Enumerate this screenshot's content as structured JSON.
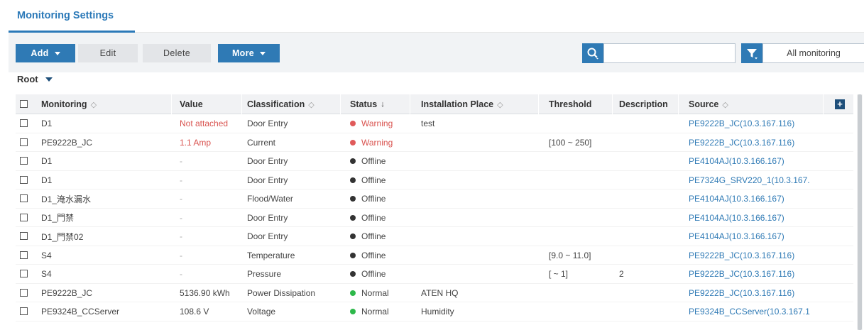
{
  "tab": {
    "label": "Monitoring Settings"
  },
  "toolbar": {
    "add_label": "Add",
    "edit_label": "Edit",
    "delete_label": "Delete",
    "more_label": "More",
    "search_value": "",
    "filter_value": "All monitoring"
  },
  "breadcrumb": {
    "root_label": "Root"
  },
  "columns": [
    "Monitoring",
    "Value",
    "Classification",
    "Status",
    "Installation Place",
    "Threshold",
    "Description",
    "Source"
  ],
  "rows": [
    {
      "monitoring": "D1",
      "value": "Not attached",
      "classification": "Door Entry",
      "status": "Warning",
      "place": "test",
      "threshold": "",
      "description": "",
      "source": "PE9222B_JC(10.3.167.116)"
    },
    {
      "monitoring": "PE9222B_JC",
      "value": "1.1 Amp",
      "classification": "Current",
      "status": "Warning",
      "place": "",
      "threshold": "[100 ~ 250]",
      "description": "",
      "source": "PE9222B_JC(10.3.167.116)"
    },
    {
      "monitoring": "D1",
      "value": "-",
      "classification": "Door Entry",
      "status": "Offline",
      "place": "",
      "threshold": "",
      "description": "",
      "source": "PE4104AJ(10.3.166.167)"
    },
    {
      "monitoring": "D1",
      "value": "-",
      "classification": "Door Entry",
      "status": "Offline",
      "place": "",
      "threshold": "",
      "description": "",
      "source": "PE7324G_SRV220_1(10.3.167."
    },
    {
      "monitoring": "D1_淹水漏水",
      "value": "-",
      "classification": "Flood/Water",
      "status": "Offline",
      "place": "",
      "threshold": "",
      "description": "",
      "source": "PE4104AJ(10.3.166.167)"
    },
    {
      "monitoring": "D1_門禁",
      "value": "-",
      "classification": "Door Entry",
      "status": "Offline",
      "place": "",
      "threshold": "",
      "description": "",
      "source": "PE4104AJ(10.3.166.167)"
    },
    {
      "monitoring": "D1_門禁02",
      "value": "-",
      "classification": "Door Entry",
      "status": "Offline",
      "place": "",
      "threshold": "",
      "description": "",
      "source": "PE4104AJ(10.3.166.167)"
    },
    {
      "monitoring": "S4",
      "value": "-",
      "classification": "Temperature",
      "status": "Offline",
      "place": "",
      "threshold": "[9.0 ~ 11.0]",
      "description": "",
      "source": "PE9222B_JC(10.3.167.116)"
    },
    {
      "monitoring": "S4",
      "value": "-",
      "classification": "Pressure",
      "status": "Offline",
      "place": "",
      "threshold": "[ ~ 1]",
      "description": "2",
      "source": "PE9222B_JC(10.3.167.116)"
    },
    {
      "monitoring": "PE9222B_JC",
      "value": "5136.90 kWh",
      "classification": "Power Dissipation",
      "status": "Normal",
      "place": "ATEN HQ",
      "threshold": "",
      "description": "",
      "source": "PE9222B_JC(10.3.167.116)"
    },
    {
      "monitoring": "PE9324B_CCServer",
      "value": "108.6 V",
      "classification": "Voltage",
      "status": "Normal",
      "place": "Humidity",
      "threshold": "",
      "description": "",
      "source": "PE9324B_CCServer(10.3.167.1"
    }
  ],
  "status_colors": {
    "Warning": "#e05a5a",
    "Offline": "#333333",
    "Normal": "#2db84a"
  },
  "icons": {
    "search": "search-icon",
    "filter": "filter-icon",
    "add_column": "plus-icon"
  }
}
